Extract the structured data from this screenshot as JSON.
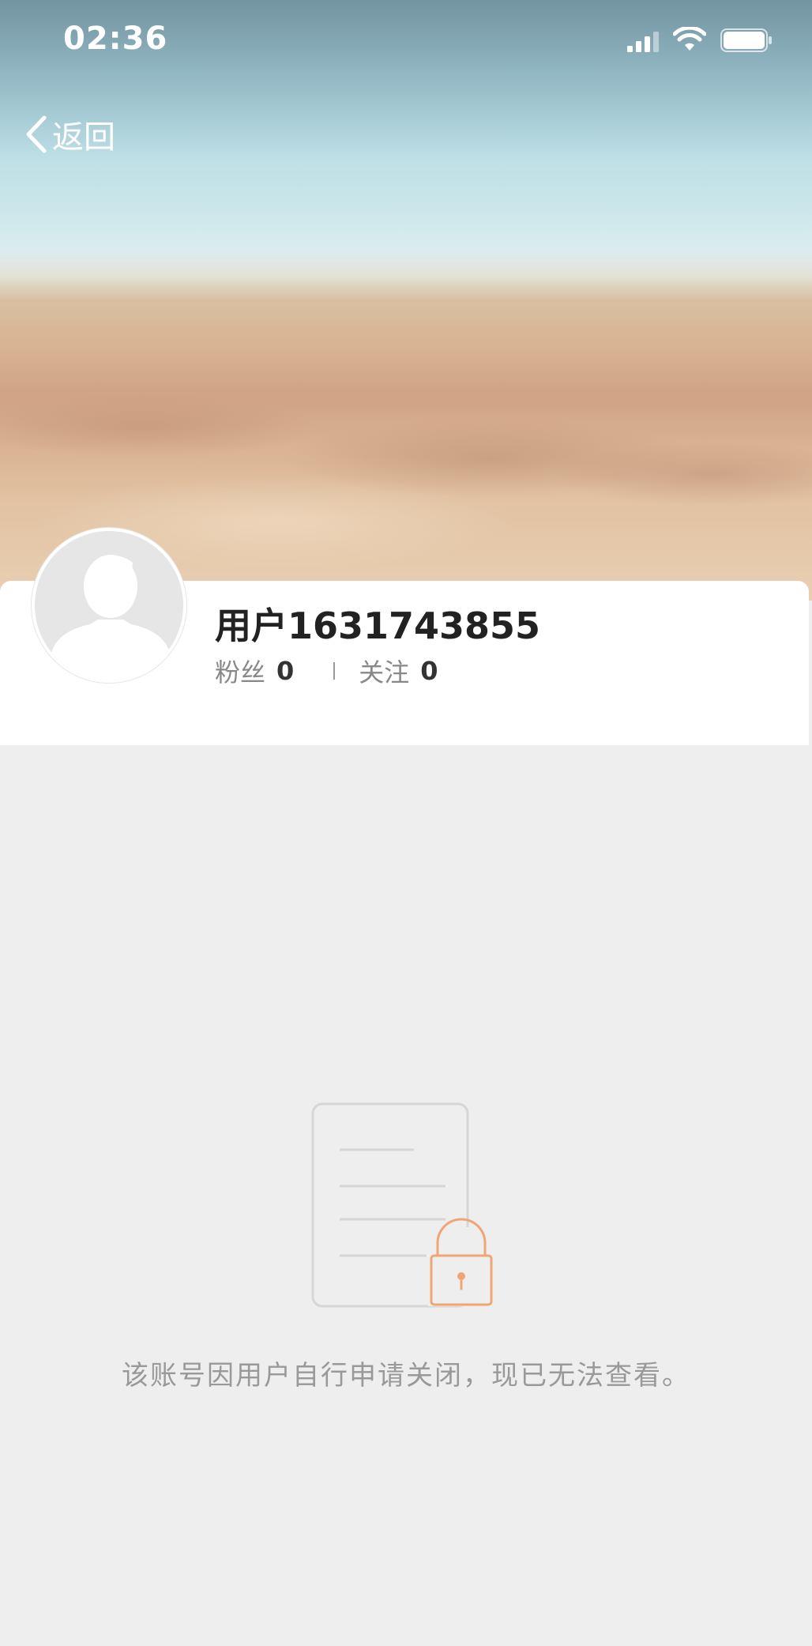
{
  "status_bar": {
    "time": "02:36"
  },
  "nav": {
    "back_label": "返回"
  },
  "profile": {
    "username": "用户1631743855",
    "followers_label": "粉丝",
    "followers_count": "0",
    "following_label": "关注",
    "following_count": "0"
  },
  "empty_state": {
    "message": "该账号因用户自行申请关闭，现已无法查看。"
  },
  "icons": {
    "signal": "signal-icon",
    "wifi": "wifi-icon",
    "battery": "battery-icon",
    "back": "chevron-left-icon",
    "avatar": "default-avatar-icon",
    "illustration": "document-lock-icon"
  },
  "colors": {
    "accent_lock": "#f0a574",
    "background": "#eeeeee",
    "card": "#ffffff",
    "muted_text": "#999999"
  }
}
